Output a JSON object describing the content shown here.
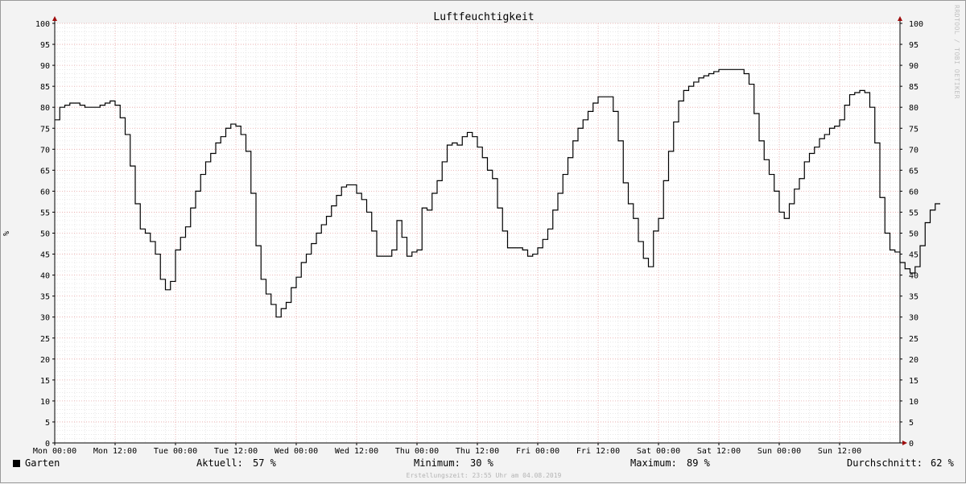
{
  "chart_data": {
    "type": "line",
    "title": "Luftfeuchtigkeit",
    "ylabel": "%",
    "ylim": [
      0,
      100
    ],
    "yticks": [
      0,
      5,
      10,
      15,
      20,
      25,
      30,
      35,
      40,
      45,
      50,
      55,
      60,
      65,
      70,
      75,
      80,
      85,
      90,
      95,
      100
    ],
    "x_tick_labels": [
      "Mon 00:00",
      "Mon 12:00",
      "Tue 00:00",
      "Tue 12:00",
      "Wed 00:00",
      "Wed 12:00",
      "Thu 00:00",
      "Thu 12:00",
      "Fri 00:00",
      "Fri 12:00",
      "Sat 00:00",
      "Sat 12:00",
      "Sun 00:00",
      "Sun 12:00"
    ],
    "x_unit": "hours since Mon 00:00",
    "xlim": [
      0,
      168
    ],
    "grid": true,
    "series": [
      {
        "name": "Garten",
        "color": "#000000",
        "step": 1,
        "values": [
          77,
          80,
          80.5,
          81,
          81,
          80.5,
          80,
          80,
          80,
          80.5,
          81,
          81.5,
          80.5,
          77.5,
          73.5,
          66,
          57,
          51,
          50,
          48,
          45,
          39,
          36.5,
          38.5,
          46,
          49,
          51.5,
          56,
          60,
          64,
          67,
          69,
          71.5,
          73,
          75,
          76,
          75.5,
          73.5,
          69.5,
          59.5,
          47,
          39,
          35.5,
          33,
          30,
          32,
          33.5,
          37,
          39.5,
          43,
          45,
          47.5,
          50,
          52,
          54,
          56.5,
          59,
          61,
          61.5,
          61.5,
          59.5,
          58,
          55,
          50.5,
          44.5,
          44.5,
          44.5,
          46,
          53,
          49,
          44.5,
          45.5,
          46,
          56,
          55.5,
          59.5,
          62.5,
          67,
          71,
          71.5,
          71,
          73,
          74,
          73,
          70.5,
          68,
          65,
          63,
          56,
          50.5,
          46.5,
          46.5,
          46.5,
          46,
          44.5,
          45,
          46.5,
          48.5,
          51,
          55.5,
          59.5,
          64,
          68,
          72,
          75,
          77,
          79,
          81,
          82.5,
          82.5,
          82.5,
          79,
          72,
          62,
          57,
          53.5,
          48,
          44,
          42,
          50.5,
          53.5,
          62.5,
          69.5,
          76.5,
          81.5,
          84,
          85,
          86,
          87,
          87.5,
          88,
          88.5,
          89,
          89,
          89,
          89,
          89,
          88,
          85.5,
          78.5,
          72,
          67.5,
          64,
          60,
          55,
          53.5,
          57,
          60.5,
          63,
          67,
          69,
          70.5,
          72.5,
          73.5,
          75,
          75.5,
          77,
          80.5,
          83,
          83.5,
          84,
          83.5,
          80,
          71.5,
          58.5,
          50,
          46,
          45.5,
          43,
          41.5,
          40.5,
          42,
          47,
          52.5,
          55.5,
          57
        ]
      }
    ]
  },
  "legend": {
    "series_name": "Garten",
    "current_label": "Aktuell:",
    "current_value": "57 %",
    "min_label": "Minimum:",
    "min_value": "30 %",
    "max_label": "Maximum:",
    "max_value": "89 %",
    "avg_label": "Durchschnitt:",
    "avg_value": "62 %"
  },
  "footer": "Erstellungszeit: 23:55 Uhr am 04.08.2019",
  "watermark": "RRDTOOL / TOBI OETIKER",
  "colors": {
    "background": "#f3f3f3",
    "plot_area": "#ffffff",
    "grid_major": "#e6a4a4",
    "grid_minor": "#d9d9d9",
    "axis": "#000000",
    "arrow": "#9e0b0b"
  }
}
